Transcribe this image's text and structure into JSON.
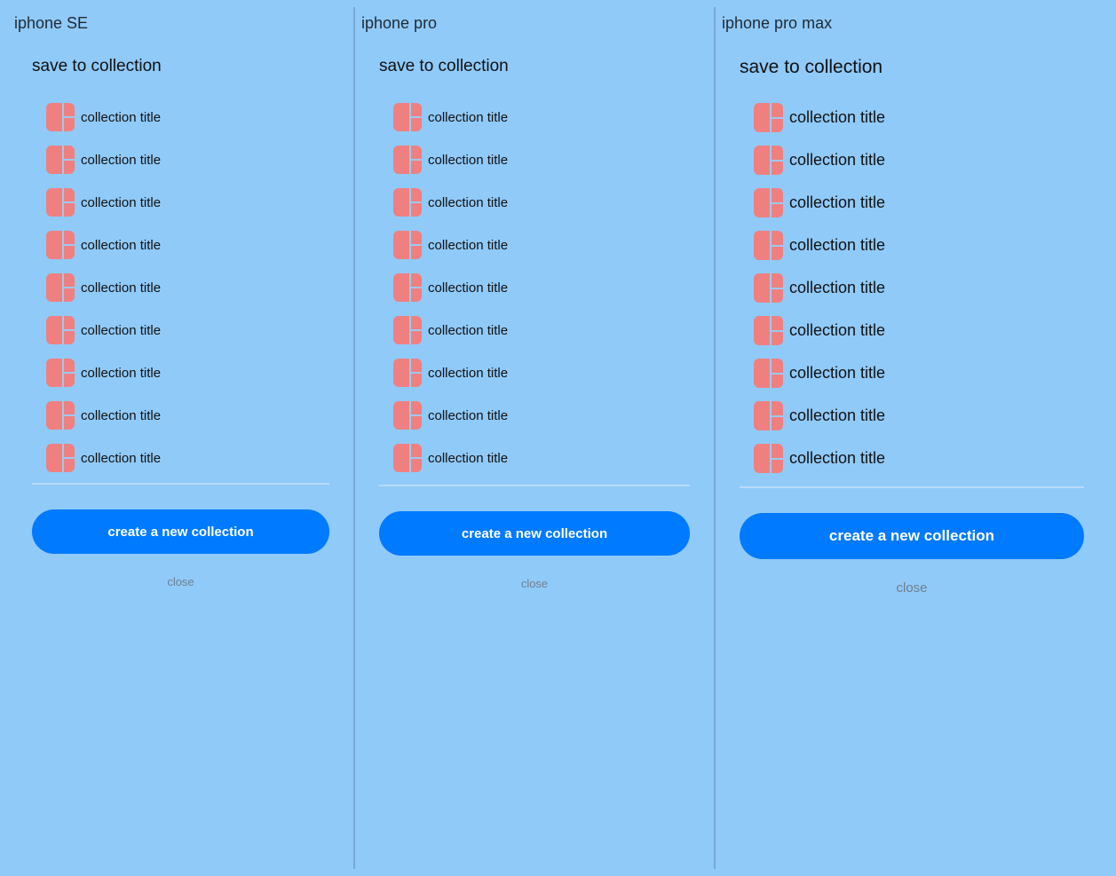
{
  "colors": {
    "background": "#90caf9",
    "accent": "#007aff",
    "thumbnail": "#f07f7f"
  },
  "panels": [
    {
      "device_label": "iphone SE",
      "sheet_title": "save to collection",
      "items": [
        {
          "label": "collection title",
          "icon": "collection-thumbnail-icon"
        },
        {
          "label": "collection title",
          "icon": "collection-thumbnail-icon"
        },
        {
          "label": "collection title",
          "icon": "collection-thumbnail-icon"
        },
        {
          "label": "collection title",
          "icon": "collection-thumbnail-icon"
        },
        {
          "label": "collection title",
          "icon": "collection-thumbnail-icon"
        },
        {
          "label": "collection title",
          "icon": "collection-thumbnail-icon"
        },
        {
          "label": "collection title",
          "icon": "collection-thumbnail-icon"
        },
        {
          "label": "collection title",
          "icon": "collection-thumbnail-icon"
        },
        {
          "label": "collection title",
          "icon": "collection-thumbnail-icon"
        }
      ],
      "create_label": "create a new collection",
      "close_label": "close"
    },
    {
      "device_label": "iphone pro",
      "sheet_title": "save to collection",
      "items": [
        {
          "label": "collection title",
          "icon": "collection-thumbnail-icon"
        },
        {
          "label": "collection title",
          "icon": "collection-thumbnail-icon"
        },
        {
          "label": "collection title",
          "icon": "collection-thumbnail-icon"
        },
        {
          "label": "collection title",
          "icon": "collection-thumbnail-icon"
        },
        {
          "label": "collection title",
          "icon": "collection-thumbnail-icon"
        },
        {
          "label": "collection title",
          "icon": "collection-thumbnail-icon"
        },
        {
          "label": "collection title",
          "icon": "collection-thumbnail-icon"
        },
        {
          "label": "collection title",
          "icon": "collection-thumbnail-icon"
        },
        {
          "label": "collection title",
          "icon": "collection-thumbnail-icon"
        }
      ],
      "create_label": "create a new collection",
      "close_label": "close"
    },
    {
      "device_label": "iphone pro max",
      "sheet_title": "save to collection",
      "items": [
        {
          "label": "collection title",
          "icon": "collection-thumbnail-icon"
        },
        {
          "label": "collection title",
          "icon": "collection-thumbnail-icon"
        },
        {
          "label": "collection title",
          "icon": "collection-thumbnail-icon"
        },
        {
          "label": "collection title",
          "icon": "collection-thumbnail-icon"
        },
        {
          "label": "collection title",
          "icon": "collection-thumbnail-icon"
        },
        {
          "label": "collection title",
          "icon": "collection-thumbnail-icon"
        },
        {
          "label": "collection title",
          "icon": "collection-thumbnail-icon"
        },
        {
          "label": "collection title",
          "icon": "collection-thumbnail-icon"
        },
        {
          "label": "collection title",
          "icon": "collection-thumbnail-icon"
        }
      ],
      "create_label": "create a new collection",
      "close_label": "close"
    }
  ]
}
